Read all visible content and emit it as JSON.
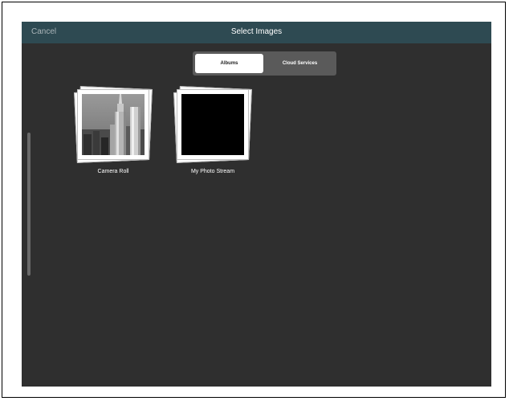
{
  "header": {
    "cancel_label": "Cancel",
    "title": "Select Images"
  },
  "tabs": [
    {
      "label": "Albums",
      "selected": true
    },
    {
      "label": "Cloud Services",
      "selected": false
    }
  ],
  "albums": [
    {
      "label": "Camera Roll",
      "thumbnail": "city-skyscraper-photo"
    },
    {
      "label": "My Photo Stream",
      "thumbnail": "black-photo"
    }
  ],
  "colors": {
    "header_bg": "#2e4a52",
    "content_bg": "#2f2f2f",
    "segment_bg": "#5a5a5a",
    "segment_selected_bg": "#ffffff"
  }
}
